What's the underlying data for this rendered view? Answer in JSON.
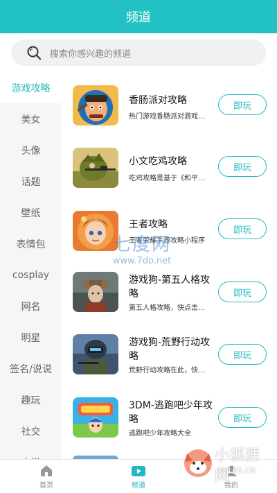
{
  "header": {
    "title": "频道"
  },
  "search": {
    "placeholder": "搜索你感兴趣的频道"
  },
  "sidebar": {
    "items": [
      {
        "label": "游戏攻略",
        "active": true
      },
      {
        "label": "美女"
      },
      {
        "label": "头像"
      },
      {
        "label": "话题"
      },
      {
        "label": "壁纸"
      },
      {
        "label": "表情包"
      },
      {
        "label": "cosplay"
      },
      {
        "label": "网名"
      },
      {
        "label": "明星"
      },
      {
        "label": "签名/说说"
      },
      {
        "label": "趣玩"
      },
      {
        "label": "社交"
      },
      {
        "label": "小说"
      }
    ]
  },
  "channels": [
    {
      "title": "香肠派对攻略",
      "desc": "热门游戏香肠派对游戏…",
      "button": "即玩",
      "icon": "sausage-party-thumbnail"
    },
    {
      "title": "小文吃鸡攻略",
      "desc": "吃鸡攻略是基于《和平…",
      "button": "即玩",
      "icon": "pubg-sniper-thumbnail"
    },
    {
      "title": "王者攻略",
      "desc": "王者荣耀手游攻略小程序",
      "button": "即玩",
      "icon": "honor-of-kings-thumbnail"
    },
    {
      "title": "游戏狗-第五人格攻略",
      "desc": "第五人格攻略，快点击…",
      "button": "即玩",
      "icon": "identity-v-thumbnail"
    },
    {
      "title": "游戏狗-荒野行动攻略",
      "desc": "荒野行动攻略在此，快…",
      "button": "即玩",
      "icon": "knives-out-thumbnail"
    },
    {
      "title": "3DM-逃跑吧少年攻略",
      "desc": "逃跑吧少年攻略大全",
      "button": "即玩",
      "icon": "escape-boy-thumbnail"
    }
  ],
  "watermark": {
    "main": "七度网",
    "url": "www.7do.net"
  },
  "logo_watermark": {
    "text": "小狐狸网",
    "url": "XHLKS.CN"
  },
  "tabbar": {
    "tabs": [
      {
        "label": "首页",
        "icon": "home-icon"
      },
      {
        "label": "频道",
        "icon": "channel-tv-icon",
        "active": true
      },
      {
        "label": "我的",
        "icon": "profile-icon"
      }
    ]
  },
  "colors": {
    "accent": "#22c1c3",
    "active_text": "#22b8bf",
    "sidebar_bg": "#f6f6f6"
  }
}
